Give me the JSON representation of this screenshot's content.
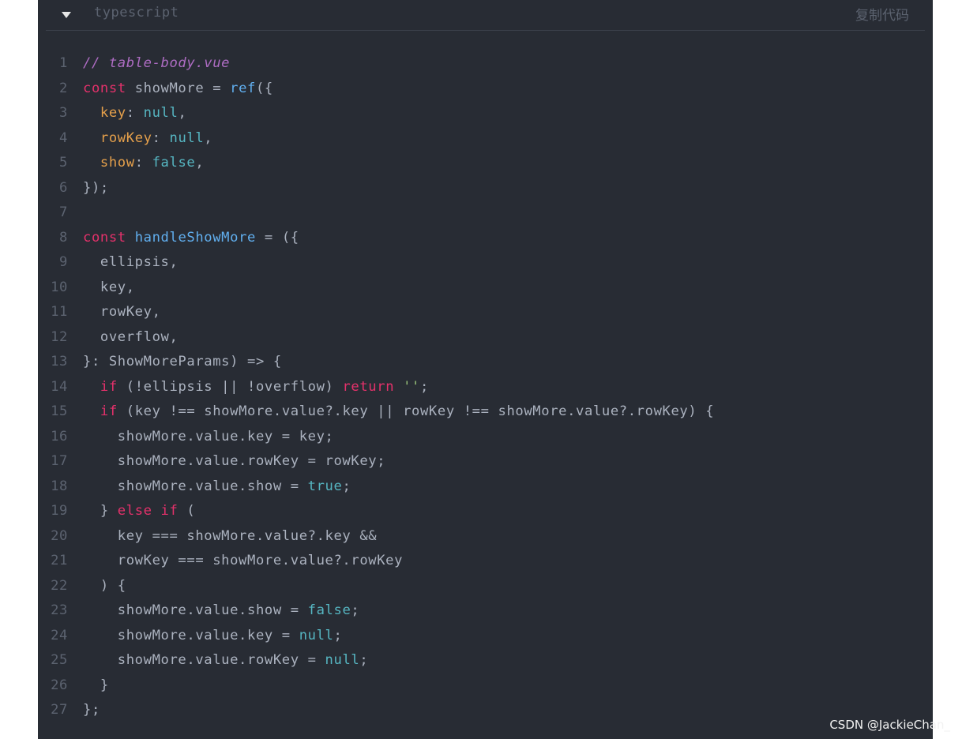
{
  "header": {
    "language": "typescript",
    "copy_label": "复制代码"
  },
  "code": {
    "lines": [
      [
        {
          "t": "comment",
          "v": "// table-body.vue"
        }
      ],
      [
        {
          "t": "keyword",
          "v": "const"
        },
        {
          "t": "plain",
          "v": " showMore = "
        },
        {
          "t": "func",
          "v": "ref"
        },
        {
          "t": "plain",
          "v": "({"
        }
      ],
      [
        {
          "t": "plain",
          "v": "  "
        },
        {
          "t": "prop",
          "v": "key"
        },
        {
          "t": "plain",
          "v": ": "
        },
        {
          "t": "null",
          "v": "null"
        },
        {
          "t": "plain",
          "v": ","
        }
      ],
      [
        {
          "t": "plain",
          "v": "  "
        },
        {
          "t": "prop",
          "v": "rowKey"
        },
        {
          "t": "plain",
          "v": ": "
        },
        {
          "t": "null",
          "v": "null"
        },
        {
          "t": "plain",
          "v": ","
        }
      ],
      [
        {
          "t": "plain",
          "v": "  "
        },
        {
          "t": "prop",
          "v": "show"
        },
        {
          "t": "plain",
          "v": ": "
        },
        {
          "t": "null",
          "v": "false"
        },
        {
          "t": "plain",
          "v": ","
        }
      ],
      [
        {
          "t": "plain",
          "v": "});"
        }
      ],
      [
        {
          "t": "plain",
          "v": ""
        }
      ],
      [
        {
          "t": "keyword",
          "v": "const"
        },
        {
          "t": "plain",
          "v": " "
        },
        {
          "t": "func",
          "v": "handleShowMore"
        },
        {
          "t": "plain",
          "v": " = ({"
        }
      ],
      [
        {
          "t": "plain",
          "v": "  ellipsis,"
        }
      ],
      [
        {
          "t": "plain",
          "v": "  key,"
        }
      ],
      [
        {
          "t": "plain",
          "v": "  rowKey,"
        }
      ],
      [
        {
          "t": "plain",
          "v": "  overflow,"
        }
      ],
      [
        {
          "t": "plain",
          "v": "}: ShowMoreParams) => {"
        }
      ],
      [
        {
          "t": "plain",
          "v": "  "
        },
        {
          "t": "keyword",
          "v": "if"
        },
        {
          "t": "plain",
          "v": " (!ellipsis || !overflow) "
        },
        {
          "t": "keyword",
          "v": "return"
        },
        {
          "t": "plain",
          "v": " "
        },
        {
          "t": "string",
          "v": "''"
        },
        {
          "t": "plain",
          "v": ";"
        }
      ],
      [
        {
          "t": "plain",
          "v": "  "
        },
        {
          "t": "keyword",
          "v": "if"
        },
        {
          "t": "plain",
          "v": " (key !== showMore.value?.key || rowKey !== showMore.value?.rowKey) {"
        }
      ],
      [
        {
          "t": "plain",
          "v": "    showMore.value.key = key;"
        }
      ],
      [
        {
          "t": "plain",
          "v": "    showMore.value.rowKey = rowKey;"
        }
      ],
      [
        {
          "t": "plain",
          "v": "    showMore.value.show = "
        },
        {
          "t": "null",
          "v": "true"
        },
        {
          "t": "plain",
          "v": ";"
        }
      ],
      [
        {
          "t": "plain",
          "v": "  } "
        },
        {
          "t": "keyword",
          "v": "else"
        },
        {
          "t": "plain",
          "v": " "
        },
        {
          "t": "keyword",
          "v": "if"
        },
        {
          "t": "plain",
          "v": " ("
        }
      ],
      [
        {
          "t": "plain",
          "v": "    key === showMore.value?.key &&"
        }
      ],
      [
        {
          "t": "plain",
          "v": "    rowKey === showMore.value?.rowKey"
        }
      ],
      [
        {
          "t": "plain",
          "v": "  ) {"
        }
      ],
      [
        {
          "t": "plain",
          "v": "    showMore.value.show = "
        },
        {
          "t": "null",
          "v": "false"
        },
        {
          "t": "plain",
          "v": ";"
        }
      ],
      [
        {
          "t": "plain",
          "v": "    showMore.value.key = "
        },
        {
          "t": "null",
          "v": "null"
        },
        {
          "t": "plain",
          "v": ";"
        }
      ],
      [
        {
          "t": "plain",
          "v": "    showMore.value.rowKey = "
        },
        {
          "t": "null",
          "v": "null"
        },
        {
          "t": "plain",
          "v": ";"
        }
      ],
      [
        {
          "t": "plain",
          "v": "  }"
        }
      ],
      [
        {
          "t": "plain",
          "v": "};"
        }
      ]
    ]
  },
  "watermark": "CSDN @JackieChan_",
  "icons": {
    "toggle": "caret-down-icon"
  },
  "colors": {
    "background": "#282c34",
    "keyword": "#e5316b",
    "function": "#61afef",
    "property": "#e5a04b",
    "literal": "#56b6c2",
    "string": "#98c379",
    "comment": "#c678dd"
  }
}
